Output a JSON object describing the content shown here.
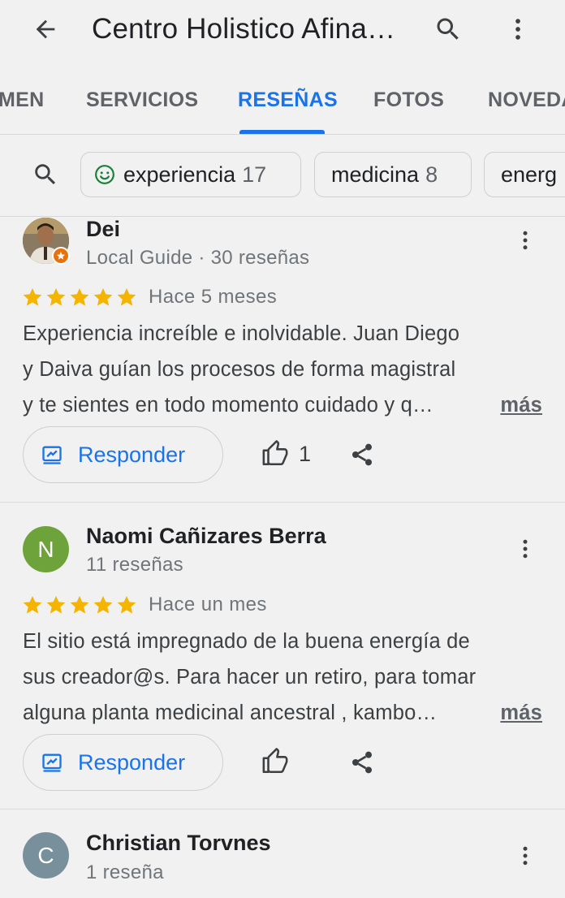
{
  "appbar": {
    "title": "Centro Holistico Afina…",
    "icons": [
      "back-arrow-icon",
      "search-icon",
      "more-vert-icon"
    ]
  },
  "tabs": [
    {
      "label": "MEN"
    },
    {
      "label": "SERVICIOS"
    },
    {
      "label": "RESEÑAS",
      "active": true
    },
    {
      "label": "FOTOS"
    },
    {
      "label": "NOVEDA"
    }
  ],
  "chips": [
    {
      "label": "experiencia",
      "count": "17",
      "icon": "smile-icon"
    },
    {
      "label": "medicina",
      "count": "8"
    },
    {
      "label": "energ",
      "count": ""
    }
  ],
  "reviews": [
    {
      "name": "Dei",
      "meta": "Local Guide · 30 reseñas",
      "stars": 5,
      "date": "Hace 5 meses",
      "lines": [
        "Experiencia increíble e inolvidable. Juan Diego",
        "y Daiva guían los procesos de forma magistral",
        "y te sientes en todo momento cuidado y q…"
      ],
      "more": "más",
      "reply": "Responder",
      "likes": "1",
      "avatar_letter": ""
    },
    {
      "name": "Naomi Cañizares Berra",
      "meta": "11 reseñas",
      "stars": 5,
      "date": "Hace un mes",
      "lines": [
        "El sitio está impregnado de la buena energía de",
        "sus creador@s. Para hacer un retiro, para tomar",
        "alguna planta medicinal ancestral , kambo…"
      ],
      "more": "más",
      "reply": "Responder",
      "likes": "",
      "avatar_letter": "N"
    },
    {
      "name": "Christian Torvnes",
      "meta": "1 reseña",
      "avatar_letter": "C"
    }
  ],
  "colors": {
    "accent": "#1a73e8",
    "star": "#f4b400",
    "avatar_n": "#6ea33c",
    "avatar_c": "#78909c",
    "smile": "#188038"
  }
}
